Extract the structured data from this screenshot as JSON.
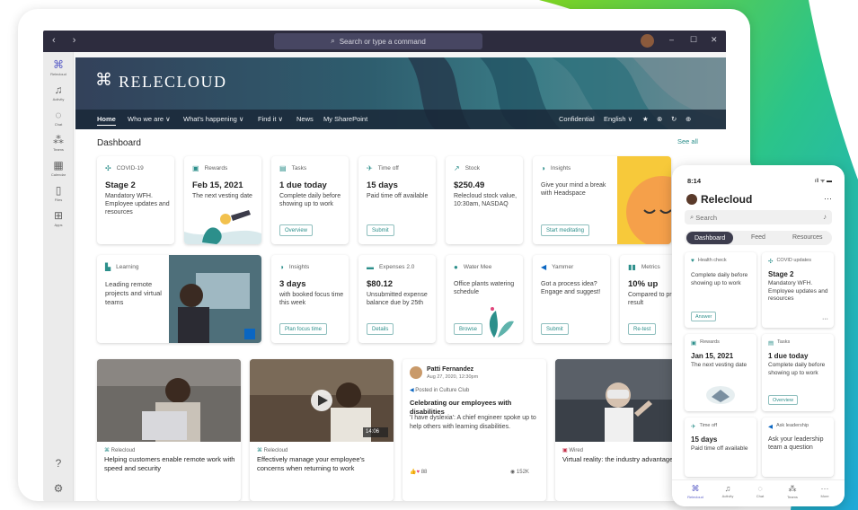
{
  "window": {
    "nav_arrows": "‹ ›",
    "search_placeholder": "Search or type a command",
    "minimize": "–",
    "maximize": "☐",
    "close": "✕"
  },
  "rail": [
    {
      "label": "Relecloud",
      "icon": "relecloud-logo-icon",
      "glyph": "⌘"
    },
    {
      "label": "Activity",
      "icon": "bell-icon",
      "glyph": "🔔"
    },
    {
      "label": "Chat",
      "icon": "chat-icon",
      "glyph": "💬"
    },
    {
      "label": "Teams",
      "icon": "teams-icon",
      "glyph": "👥"
    },
    {
      "label": "Calendar",
      "icon": "calendar-icon",
      "glyph": "▦"
    },
    {
      "label": "Files",
      "icon": "files-icon",
      "glyph": "▯"
    },
    {
      "label": "Apps",
      "icon": "apps-icon",
      "glyph": "⊞"
    }
  ],
  "rail_bottom": {
    "help_glyph": "?",
    "settings_glyph": "⚙"
  },
  "site": {
    "logo_glyph": "⌘",
    "brand": "RELECLOUD",
    "menu": [
      "Home",
      "Who we are ∨",
      "What's happening ∨",
      "Find it ∨",
      "News",
      "My SharePoint"
    ],
    "menu_right": [
      "Confidential",
      "English ∨"
    ],
    "menu_icons": [
      "★",
      "⊗",
      "↻",
      "⊕"
    ]
  },
  "dashboard": {
    "title": "Dashboard",
    "see_all": "See all",
    "cards_row1": [
      {
        "icon": "virus-icon",
        "glyph": "✣",
        "header": "COVID-19",
        "title": "Stage 2",
        "body": "Mandatory WFH. Employee updates and resources",
        "button": ""
      },
      {
        "icon": "gift-icon",
        "glyph": "🎁",
        "header": "Rewards",
        "title": "Feb 15, 2021",
        "body": "The next vesting date",
        "button": ""
      },
      {
        "icon": "clipboard-icon",
        "glyph": "▤",
        "header": "Tasks",
        "title": "1 due today",
        "body": "Complete daily before showing up to work",
        "button": "Overview"
      },
      {
        "icon": "airplane-icon",
        "glyph": "✈",
        "header": "Time off",
        "title": "15 days",
        "body": "Paid time off available",
        "button": "Submit"
      },
      {
        "icon": "chart-up-icon",
        "glyph": "↗",
        "header": "Stock",
        "title": "$250.49",
        "body": "Relecloud stock value, 10:30am, NASDAQ",
        "button": ""
      },
      {
        "icon": "insights-icon",
        "glyph": "◑",
        "header": "Insights",
        "title": "",
        "body": "Give your mind a break with Headspace",
        "button": "Start meditating"
      }
    ],
    "cards_row2": [
      {
        "icon": "book-icon",
        "glyph": "▙",
        "header": "Learning",
        "title": "",
        "body": "Leading remote projects and virtual teams",
        "button": ""
      },
      {
        "icon": "insights-icon",
        "glyph": "◑",
        "header": "Insights",
        "title": "3 days",
        "body": "with booked focus time this week",
        "button": "Plan focus time"
      },
      {
        "icon": "receipt-icon",
        "glyph": "▬",
        "header": "Expenses 2.0",
        "title": "$80.12",
        "body": "Unsubmitted expense balance due by 25th",
        "button": "Details"
      },
      {
        "icon": "water-drop-icon",
        "glyph": "●",
        "header": "Water Mee",
        "title": "",
        "body": "Office plants watering schedule",
        "button": "Browse"
      },
      {
        "icon": "megaphone-icon",
        "glyph": "📣",
        "header": "Yammer",
        "title": "",
        "body": "Got a process idea? Engage and suggest!",
        "button": "Submit"
      },
      {
        "icon": "metrics-icon",
        "glyph": "▮▮",
        "header": "Metrics",
        "title": "10% up",
        "body": "Compared to previous result",
        "button": "Re-test"
      }
    ]
  },
  "news": [
    {
      "source": "Relecloud",
      "caption": "Helping customers enable remote work with speed and security"
    },
    {
      "source": "Relecloud",
      "caption": "Effectively manage your employee's concerns when returning to work",
      "duration": "14:06"
    },
    {
      "author": "Patti Fernandez",
      "date": "Aug 27, 2020, 12:30pm",
      "posted": "Posted in Culture Club",
      "headline": "Celebrating our employees with disabilities",
      "body": "'I have dyslexia': A chief engineer spoke up to help others with learning disabilities.",
      "reactions": "88",
      "views": "152K"
    },
    {
      "source": "Wired",
      "caption": "Virtual reality: the industry advantage"
    }
  ],
  "phone": {
    "time": "8:14",
    "status": "ıll ᯤ ▬",
    "title": "Relecloud",
    "more": "···",
    "search": "Search",
    "tabs": [
      "Dashboard",
      "Feed",
      "Resources"
    ],
    "cards": [
      {
        "icon": "heart-icon",
        "glyph": "♥",
        "header": "Health check",
        "title": "",
        "body": "Complete daily before showing up to work",
        "button": "Answer"
      },
      {
        "icon": "virus-icon",
        "glyph": "✣",
        "header": "COVID updates",
        "title": "Stage 2",
        "body": "Mandatory WFH. Employee updates and resources",
        "button": "",
        "dots": "···"
      },
      {
        "icon": "gift-icon",
        "glyph": "🎁",
        "header": "Rewards",
        "title": "Jan 15, 2021",
        "body": "The next vesting date",
        "button": ""
      },
      {
        "icon": "clipboard-icon",
        "glyph": "▤",
        "header": "Tasks",
        "title": "1 due today",
        "body": "Complete daily before showing up to work",
        "button": "Overview"
      },
      {
        "icon": "airplane-icon",
        "glyph": "✈",
        "header": "Time off",
        "title": "15 days",
        "body": "Paid time off available",
        "button": ""
      },
      {
        "icon": "megaphone-icon",
        "glyph": "📣",
        "header": "Ask leadership",
        "title": "",
        "body": "Ask your leadership team a question",
        "button": ""
      }
    ],
    "bottom_tabs": [
      {
        "label": "Relecloud",
        "glyph": "⌘"
      },
      {
        "label": "Activity",
        "glyph": "🔔"
      },
      {
        "label": "Chat",
        "glyph": "💬"
      },
      {
        "label": "Teams",
        "glyph": "👥"
      },
      {
        "label": "More",
        "glyph": "···"
      }
    ]
  },
  "colors": {
    "accent": "#2c8f8b",
    "teams_purple": "#5b5fc7",
    "hero_dark": "#33415a"
  }
}
